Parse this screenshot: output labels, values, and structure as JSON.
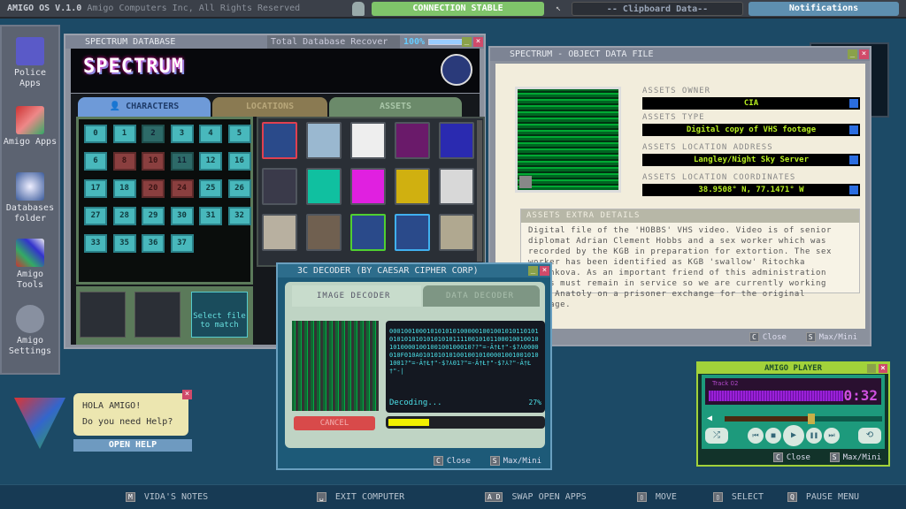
{
  "topbar": {
    "brand": "AMIGO OS V.1.0",
    "copyright": "Amigo Computers Inc, All Rights Reserved",
    "connection": "CONNECTION STABLE",
    "clipboard": "-- Clipboard Data--",
    "notifications": "Notifications"
  },
  "sidebar": {
    "items": [
      {
        "label": "Police Apps",
        "icon": "floppy-disk-icon"
      },
      {
        "label": "Amigo Apps",
        "icon": "amigo-apps-icon"
      },
      {
        "label": "Databases folder",
        "icon": "database-icon"
      },
      {
        "label": "Amigo Tools",
        "icon": "tools-icon"
      },
      {
        "label": "Amigo Settings",
        "icon": "gear-icon"
      }
    ]
  },
  "db": {
    "title": "SPECTRUM DATABASE",
    "recover_label": "Total Database Recover",
    "recover_pct": "100%",
    "recover_value": 100,
    "logo": "SPECTRUM",
    "tabs": [
      "CHARACTERS",
      "LOCATIONS",
      "ASSETS"
    ],
    "folders": [
      {
        "n": "0",
        "s": "ok"
      },
      {
        "n": "1",
        "s": "ok"
      },
      {
        "n": "2",
        "s": "dim"
      },
      {
        "n": "3",
        "s": "ok"
      },
      {
        "n": "4",
        "s": "ok"
      },
      {
        "n": "5",
        "s": "ok"
      },
      {
        "n": "6",
        "s": "ok"
      },
      {
        "n": "8",
        "s": "red"
      },
      {
        "n": "10",
        "s": "red"
      },
      {
        "n": "11",
        "s": "dim"
      },
      {
        "n": "12",
        "s": "ok"
      },
      {
        "n": "16",
        "s": "ok"
      },
      {
        "n": "17",
        "s": "ok"
      },
      {
        "n": "18",
        "s": "ok"
      },
      {
        "n": "20",
        "s": "red"
      },
      {
        "n": "24",
        "s": "red"
      },
      {
        "n": "25",
        "s": "ok"
      },
      {
        "n": "26",
        "s": "ok"
      },
      {
        "n": "27",
        "s": "ok"
      },
      {
        "n": "28",
        "s": "ok"
      },
      {
        "n": "29",
        "s": "ok"
      },
      {
        "n": "30",
        "s": "ok"
      },
      {
        "n": "31",
        "s": "ok"
      },
      {
        "n": "32",
        "s": "ok"
      },
      {
        "n": "33",
        "s": "ok"
      },
      {
        "n": "35",
        "s": "ok"
      },
      {
        "n": "36",
        "s": "ok"
      },
      {
        "n": "37",
        "s": "ok"
      }
    ],
    "assets": [
      {
        "c": "#2a4a8a",
        "b": "#e04050"
      },
      {
        "c": "#9ab8d0",
        "b": "#50565e"
      },
      {
        "c": "#eeeeee",
        "b": "#50565e"
      },
      {
        "c": "#6a1a6a",
        "b": "#50565e"
      },
      {
        "c": "#2a2ab0",
        "b": "#50565e"
      },
      {
        "c": "#3a3a4a",
        "b": "#50565e"
      },
      {
        "c": "#10c0a0",
        "b": "#50565e"
      },
      {
        "c": "#e020e0",
        "b": "#50565e"
      },
      {
        "c": "#d0b010",
        "b": "#50565e"
      },
      {
        "c": "#d8d8d8",
        "b": "#50565e"
      },
      {
        "c": "#b8b0a0",
        "b": "#50565e"
      },
      {
        "c": "#706050",
        "b": "#50565e"
      },
      {
        "c": "#2a4a8a",
        "b": "#50d030"
      },
      {
        "c": "#2a4a8a",
        "b": "#40b0f0"
      },
      {
        "c": "#b0a890",
        "b": "#50565e"
      }
    ],
    "select_file": "Select file to match"
  },
  "obj": {
    "title": "SPECTRUM - OBJECT DATA FILE",
    "fields": [
      {
        "label": "ASSETS OWNER",
        "value": "CIA"
      },
      {
        "label": "ASSETS TYPE",
        "value": "Digital copy of VHS footage"
      },
      {
        "label": "ASSETS LOCATION ADDRESS",
        "value": "Langley/Night Sky Server"
      },
      {
        "label": "ASSETS LOCATION COORDINATES",
        "value": "38.9508° N, 77.1471° W"
      }
    ],
    "details_title": "ASSETS EXTRA DETAILS",
    "details": "Digital file of the 'HOBBS' VHS video.  Video is of senior diplomat Adrian Clement Hobbs and a sex worker which was recorded by the KGB in preparation for extortion. The sex worker has been identified as KGB 'swallow' Ritochka Kazankova. As an important friend of this administration Hobbs must remain in service so we are currently working with Anatoly on a prisoner exchange for the original footage.",
    "close": "Close",
    "close_key": "C",
    "max": "Max/Mini",
    "max_key": "S"
  },
  "dec": {
    "title": "3C DECODER (BY CAESAR CIPHER CORP)",
    "tabs": [
      "IMAGE DECODER",
      "DATA DECODER"
    ],
    "stream": "000100100010101010100000100100101011010101010101010101010111100101011000100100101010000100100100100010??\"=-Ã†Ł†\"-$?⅄0000010F010A010101010100100101000010010010101001?\"=-Ã†Ł†\"-$?⅄01?\"=-Ã†Ł†\"-$?⅄?\"-Ã†Ł†\"-|",
    "status": "Decoding...",
    "pct": "27%",
    "progress": 27,
    "cancel": "CANCEL",
    "close": "Close",
    "close_key": "C",
    "max": "Max/Mini",
    "max_key": "S"
  },
  "player": {
    "title": "AMIGO PLAYER",
    "track": "Track 02",
    "time": "0:32",
    "volume": 0.55,
    "close": "Close",
    "close_key": "C",
    "max": "Max/Mini",
    "max_key": "S"
  },
  "helper": {
    "line1": "HOLA AMIGO!",
    "line2": "Do you need Help?",
    "button": "OPEN HELP"
  },
  "bottombar": [
    {
      "key": "M",
      "label": "VIDA'S NOTES"
    },
    {
      "key": "␣",
      "label": "EXIT COMPUTER"
    },
    {
      "key": "A D",
      "label": "SWAP OPEN APPS"
    },
    {
      "key": "▯",
      "label": "MOVE"
    },
    {
      "key": "▯",
      "label": "SELECT"
    },
    {
      "key": "Q",
      "label": "PAUSE MENU"
    }
  ]
}
